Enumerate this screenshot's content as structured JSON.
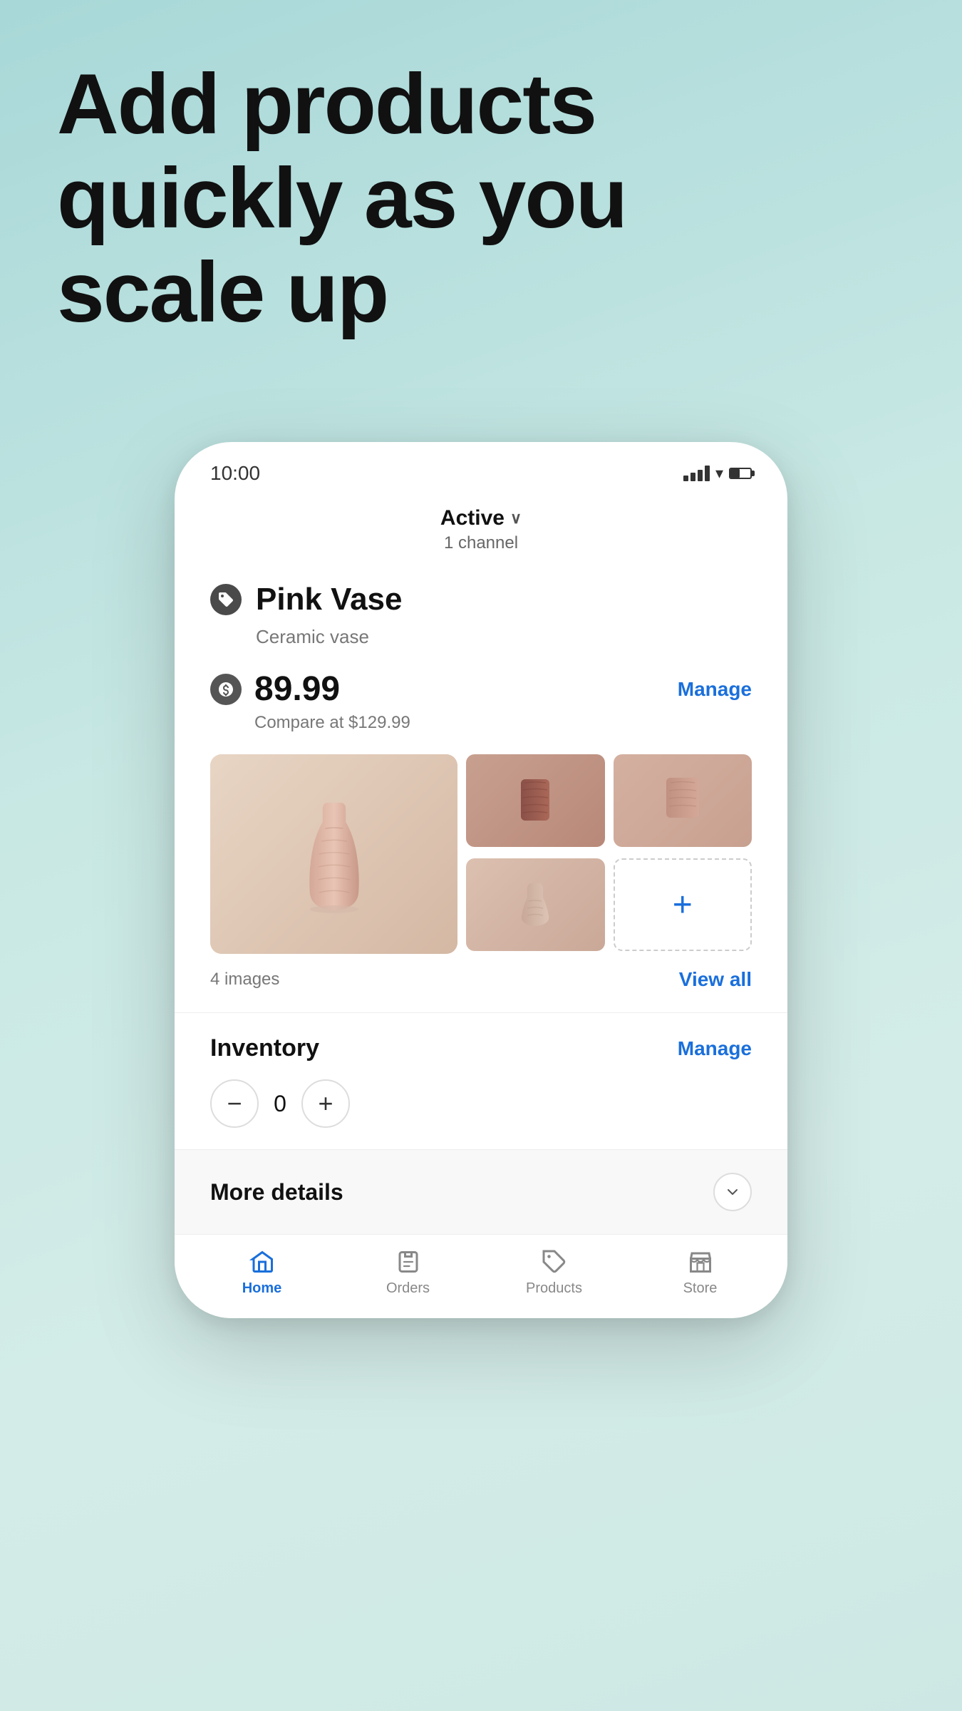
{
  "hero": {
    "title_line1": "Add products",
    "title_line2": "quickly as you",
    "title_line3": "scale up"
  },
  "status_bar": {
    "time": "10:00"
  },
  "product_status": {
    "status": "Active",
    "channel_count": "1 channel"
  },
  "product": {
    "name": "Pink Vase",
    "description": "Ceramic vase",
    "price": "89.99",
    "compare_price": "Compare at $129.99",
    "image_count": "4 images",
    "manage_label": "Manage",
    "view_all_label": "View all"
  },
  "inventory": {
    "title": "Inventory",
    "manage_label": "Manage",
    "quantity": "0"
  },
  "more_details": {
    "title": "More details"
  },
  "bottom_nav": {
    "home": "Home",
    "orders": "Orders",
    "products": "Products",
    "store": "Store"
  }
}
